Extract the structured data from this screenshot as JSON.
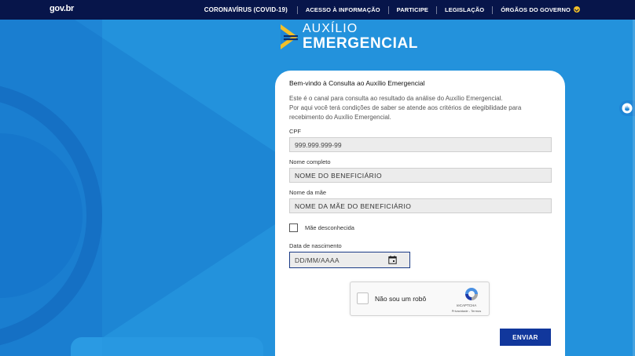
{
  "topbar": {
    "brand": "gov.br",
    "nav": [
      "CORONAVÍRUS (COVID-19)",
      "ACESSO À INFORMAÇÃO",
      "PARTICIPE",
      "LEGISLAÇÃO",
      "ÓRGÃOS DO GOVERNO"
    ]
  },
  "logo": {
    "line1": "AUXÍLIO",
    "line2": "EMERGENCIAL"
  },
  "form": {
    "title": "Bem-vindo à Consulta ao Auxílio Emergencial",
    "description": [
      "Este é o canal para consulta ao resultado da análise do Auxílio Emergencial.",
      "Por aqui você terá condições de saber se atende aos critérios de elegibilidade para recebimento do Auxílio Emergencial."
    ],
    "cpf_label": "CPF",
    "cpf_placeholder": "999.999.999-99",
    "name_label": "Nome completo",
    "name_placeholder": "NOME DO BENEFICIÁRIO",
    "mother_label": "Nome da mãe",
    "mother_placeholder": "NOME DA MÃE DO BENEFICIÁRIO",
    "unknown_mother_label": "Mãe desconhecida",
    "birth_label": "Data de nascimento",
    "birth_placeholder": "DD/MM/AAAA",
    "submit_label": "ENVIAR"
  },
  "captcha": {
    "label": "Não sou um robô",
    "brand": "reCAPTCHA",
    "links": "Privacidade - Termos"
  },
  "colors": {
    "topbar": "#07154a",
    "background": "#1f86d6",
    "submit": "#11379c",
    "accent_yellow": "#f2c029"
  }
}
